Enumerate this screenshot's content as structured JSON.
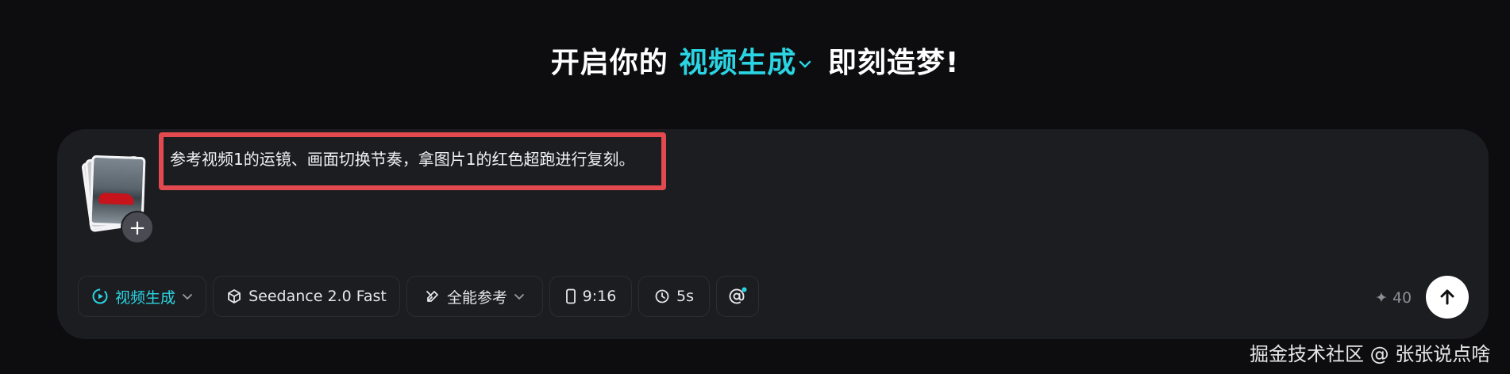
{
  "headline": {
    "prefix": "开启你的",
    "mode": "视频生成",
    "suffix": "即刻造梦!"
  },
  "prompt": {
    "text": "参考视频1的运镜、画面切换节奏，拿图片1的红色超跑进行复刻。",
    "highlight_color": "#e24a4f"
  },
  "attachments": {
    "add_icon": "plus-icon"
  },
  "toolbar": {
    "mode_label": "视频生成",
    "model_label": "Seedance 2.0 Fast",
    "reference_label": "全能参考",
    "ratio_label": "9:16",
    "duration_label": "5s",
    "mention_icon": "at-icon"
  },
  "credits": {
    "value": "40",
    "icon": "sparkle-icon"
  },
  "send": {
    "icon": "arrow-up-icon"
  },
  "watermark": "掘金技术社区 @ 张张说点啥",
  "colors": {
    "accent": "#2bd4e2",
    "background": "#0d0d10",
    "panel": "#1c1d21"
  }
}
